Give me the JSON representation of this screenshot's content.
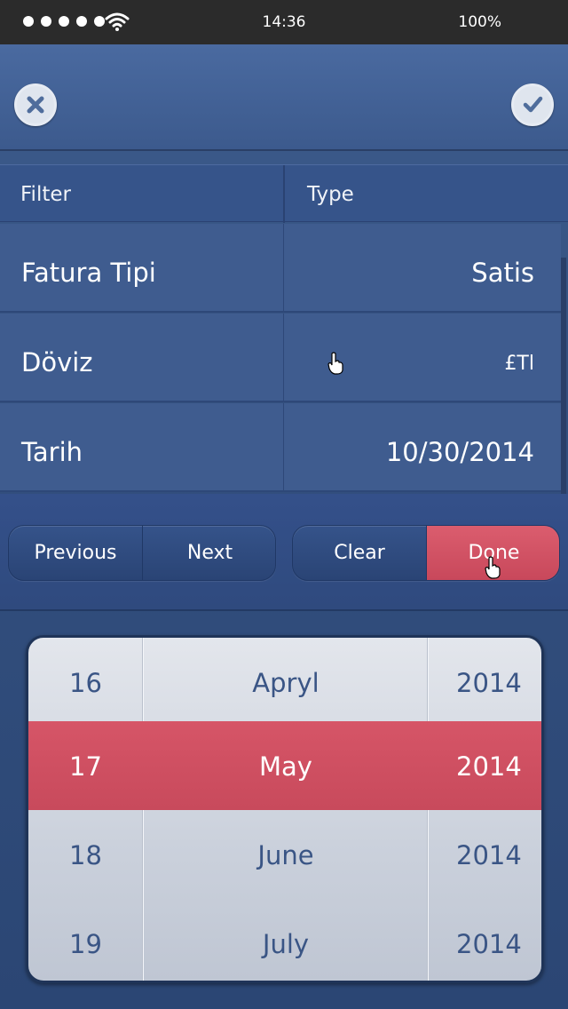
{
  "status_bar": {
    "time": "14:36",
    "battery": "100%"
  },
  "header": {
    "close_icon": "close-circle-icon",
    "confirm_icon": "check-circle-icon"
  },
  "filter": {
    "headers": [
      "Filter",
      "Type"
    ],
    "rows": [
      {
        "name": "Fatura Tipi",
        "value": "Satis"
      },
      {
        "name": "Döviz",
        "value": "£Tl"
      },
      {
        "name": "Tarih",
        "value": "10/30/2014"
      }
    ]
  },
  "toolbar": {
    "previous_label": "Previous",
    "next_label": "Next",
    "clear_label": "Clear",
    "done_label": "Done"
  },
  "date_picker": {
    "rows": [
      {
        "day": "16",
        "month": "Apryl",
        "year": "2014",
        "selected": false
      },
      {
        "day": "17",
        "month": "May",
        "year": "2014",
        "selected": true
      },
      {
        "day": "18",
        "month": "June",
        "year": "2014",
        "selected": false
      },
      {
        "day": "19",
        "month": "July",
        "year": "2014",
        "selected": false
      }
    ]
  },
  "colors": {
    "accent": "#d65567",
    "background": "#3f5c8f",
    "status_bar": "#2b2b2b"
  }
}
